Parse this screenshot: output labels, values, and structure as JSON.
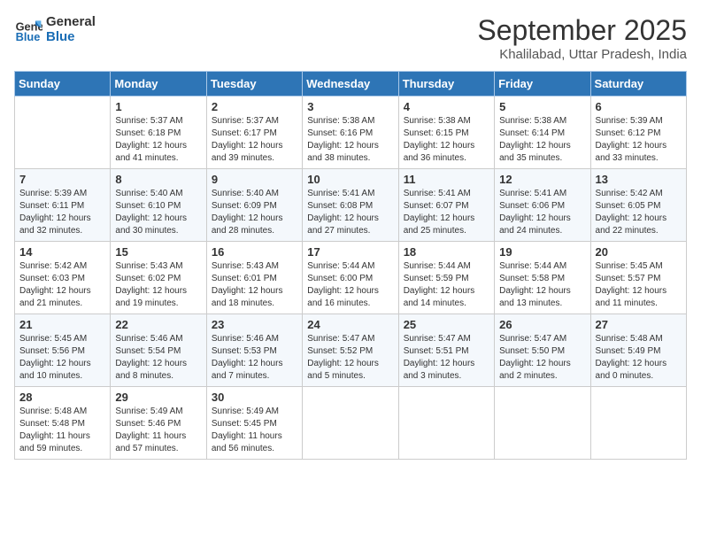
{
  "logo": {
    "line1": "General",
    "line2": "Blue"
  },
  "title": "September 2025",
  "subtitle": "Khalilabad, Uttar Pradesh, India",
  "weekdays": [
    "Sunday",
    "Monday",
    "Tuesday",
    "Wednesday",
    "Thursday",
    "Friday",
    "Saturday"
  ],
  "weeks": [
    [
      {
        "day": "",
        "sunrise": "",
        "sunset": "",
        "daylight": ""
      },
      {
        "day": "1",
        "sunrise": "Sunrise: 5:37 AM",
        "sunset": "Sunset: 6:18 PM",
        "daylight": "Daylight: 12 hours and 41 minutes."
      },
      {
        "day": "2",
        "sunrise": "Sunrise: 5:37 AM",
        "sunset": "Sunset: 6:17 PM",
        "daylight": "Daylight: 12 hours and 39 minutes."
      },
      {
        "day": "3",
        "sunrise": "Sunrise: 5:38 AM",
        "sunset": "Sunset: 6:16 PM",
        "daylight": "Daylight: 12 hours and 38 minutes."
      },
      {
        "day": "4",
        "sunrise": "Sunrise: 5:38 AM",
        "sunset": "Sunset: 6:15 PM",
        "daylight": "Daylight: 12 hours and 36 minutes."
      },
      {
        "day": "5",
        "sunrise": "Sunrise: 5:38 AM",
        "sunset": "Sunset: 6:14 PM",
        "daylight": "Daylight: 12 hours and 35 minutes."
      },
      {
        "day": "6",
        "sunrise": "Sunrise: 5:39 AM",
        "sunset": "Sunset: 6:12 PM",
        "daylight": "Daylight: 12 hours and 33 minutes."
      }
    ],
    [
      {
        "day": "7",
        "sunrise": "Sunrise: 5:39 AM",
        "sunset": "Sunset: 6:11 PM",
        "daylight": "Daylight: 12 hours and 32 minutes."
      },
      {
        "day": "8",
        "sunrise": "Sunrise: 5:40 AM",
        "sunset": "Sunset: 6:10 PM",
        "daylight": "Daylight: 12 hours and 30 minutes."
      },
      {
        "day": "9",
        "sunrise": "Sunrise: 5:40 AM",
        "sunset": "Sunset: 6:09 PM",
        "daylight": "Daylight: 12 hours and 28 minutes."
      },
      {
        "day": "10",
        "sunrise": "Sunrise: 5:41 AM",
        "sunset": "Sunset: 6:08 PM",
        "daylight": "Daylight: 12 hours and 27 minutes."
      },
      {
        "day": "11",
        "sunrise": "Sunrise: 5:41 AM",
        "sunset": "Sunset: 6:07 PM",
        "daylight": "Daylight: 12 hours and 25 minutes."
      },
      {
        "day": "12",
        "sunrise": "Sunrise: 5:41 AM",
        "sunset": "Sunset: 6:06 PM",
        "daylight": "Daylight: 12 hours and 24 minutes."
      },
      {
        "day": "13",
        "sunrise": "Sunrise: 5:42 AM",
        "sunset": "Sunset: 6:05 PM",
        "daylight": "Daylight: 12 hours and 22 minutes."
      }
    ],
    [
      {
        "day": "14",
        "sunrise": "Sunrise: 5:42 AM",
        "sunset": "Sunset: 6:03 PM",
        "daylight": "Daylight: 12 hours and 21 minutes."
      },
      {
        "day": "15",
        "sunrise": "Sunrise: 5:43 AM",
        "sunset": "Sunset: 6:02 PM",
        "daylight": "Daylight: 12 hours and 19 minutes."
      },
      {
        "day": "16",
        "sunrise": "Sunrise: 5:43 AM",
        "sunset": "Sunset: 6:01 PM",
        "daylight": "Daylight: 12 hours and 18 minutes."
      },
      {
        "day": "17",
        "sunrise": "Sunrise: 5:44 AM",
        "sunset": "Sunset: 6:00 PM",
        "daylight": "Daylight: 12 hours and 16 minutes."
      },
      {
        "day": "18",
        "sunrise": "Sunrise: 5:44 AM",
        "sunset": "Sunset: 5:59 PM",
        "daylight": "Daylight: 12 hours and 14 minutes."
      },
      {
        "day": "19",
        "sunrise": "Sunrise: 5:44 AM",
        "sunset": "Sunset: 5:58 PM",
        "daylight": "Daylight: 12 hours and 13 minutes."
      },
      {
        "day": "20",
        "sunrise": "Sunrise: 5:45 AM",
        "sunset": "Sunset: 5:57 PM",
        "daylight": "Daylight: 12 hours and 11 minutes."
      }
    ],
    [
      {
        "day": "21",
        "sunrise": "Sunrise: 5:45 AM",
        "sunset": "Sunset: 5:56 PM",
        "daylight": "Daylight: 12 hours and 10 minutes."
      },
      {
        "day": "22",
        "sunrise": "Sunrise: 5:46 AM",
        "sunset": "Sunset: 5:54 PM",
        "daylight": "Daylight: 12 hours and 8 minutes."
      },
      {
        "day": "23",
        "sunrise": "Sunrise: 5:46 AM",
        "sunset": "Sunset: 5:53 PM",
        "daylight": "Daylight: 12 hours and 7 minutes."
      },
      {
        "day": "24",
        "sunrise": "Sunrise: 5:47 AM",
        "sunset": "Sunset: 5:52 PM",
        "daylight": "Daylight: 12 hours and 5 minutes."
      },
      {
        "day": "25",
        "sunrise": "Sunrise: 5:47 AM",
        "sunset": "Sunset: 5:51 PM",
        "daylight": "Daylight: 12 hours and 3 minutes."
      },
      {
        "day": "26",
        "sunrise": "Sunrise: 5:47 AM",
        "sunset": "Sunset: 5:50 PM",
        "daylight": "Daylight: 12 hours and 2 minutes."
      },
      {
        "day": "27",
        "sunrise": "Sunrise: 5:48 AM",
        "sunset": "Sunset: 5:49 PM",
        "daylight": "Daylight: 12 hours and 0 minutes."
      }
    ],
    [
      {
        "day": "28",
        "sunrise": "Sunrise: 5:48 AM",
        "sunset": "Sunset: 5:48 PM",
        "daylight": "Daylight: 11 hours and 59 minutes."
      },
      {
        "day": "29",
        "sunrise": "Sunrise: 5:49 AM",
        "sunset": "Sunset: 5:46 PM",
        "daylight": "Daylight: 11 hours and 57 minutes."
      },
      {
        "day": "30",
        "sunrise": "Sunrise: 5:49 AM",
        "sunset": "Sunset: 5:45 PM",
        "daylight": "Daylight: 11 hours and 56 minutes."
      },
      {
        "day": "",
        "sunrise": "",
        "sunset": "",
        "daylight": ""
      },
      {
        "day": "",
        "sunrise": "",
        "sunset": "",
        "daylight": ""
      },
      {
        "day": "",
        "sunrise": "",
        "sunset": "",
        "daylight": ""
      },
      {
        "day": "",
        "sunrise": "",
        "sunset": "",
        "daylight": ""
      }
    ]
  ]
}
